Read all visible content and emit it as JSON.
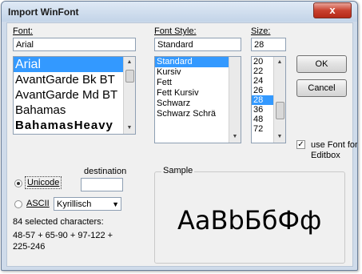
{
  "window": {
    "title": "Import WinFont",
    "close_glyph": "x"
  },
  "font": {
    "label": "Font:",
    "value": "Arial",
    "items": [
      "Arial",
      "AvantGarde Bk BT",
      "AvantGarde Md BT",
      "Bahamas",
      "BahamasHeavy"
    ],
    "selected": "Arial"
  },
  "style": {
    "label": "Font Style:",
    "value": "Standard",
    "items": [
      "Standard",
      "Kursiv",
      "Fett",
      "Fett Kursiv",
      "Schwarz",
      "Schwarz Schrä"
    ],
    "selected": "Standard"
  },
  "size": {
    "label": "Size:",
    "value": "28",
    "items": [
      "20",
      "22",
      "24",
      "26",
      "28",
      "36",
      "48",
      "72"
    ],
    "selected": "28"
  },
  "buttons": {
    "ok": "OK",
    "cancel": "Cancel"
  },
  "editbox_checkbox": {
    "label_line1": "use Font for",
    "label_line2": "Editbox",
    "checked": true,
    "mark": "✓"
  },
  "destination": {
    "label": "destination",
    "unicode_label": "Unicode",
    "ascii_label": "ASCII",
    "ascii_value": "Kyrillisch",
    "selected": "Unicode"
  },
  "selection_info": {
    "count_text": "84 selected characters:",
    "ranges_line1": "48-57 + 65-90 + 97-122 +",
    "ranges_line2": "225-246"
  },
  "sample": {
    "label": "Sample",
    "text": "AaBbБбФф"
  }
}
